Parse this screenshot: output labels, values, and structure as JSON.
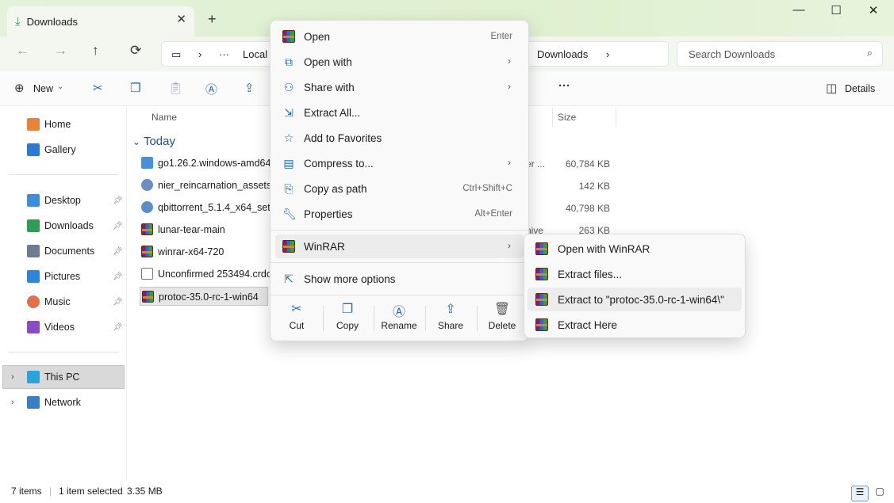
{
  "window": {
    "tab_title": "Downloads",
    "new_tab": "+",
    "minimize": "—",
    "maximize": "☐",
    "close": "✕"
  },
  "nav": {
    "back": "←",
    "forward": "→",
    "up": "↑",
    "refresh": "⟳",
    "address_ellipsis": "···",
    "address_local": "Local",
    "address_current": "Downloads",
    "search_placeholder": "Search Downloads"
  },
  "commandbar": {
    "new_label": "New",
    "more": "···",
    "details_label": "Details"
  },
  "sidebar": {
    "items_top": [
      {
        "label": "Home",
        "color": "#e8833a"
      },
      {
        "label": "Gallery",
        "color": "#2b78d6"
      }
    ],
    "items_quick": [
      {
        "label": "Desktop",
        "color": "#3a8fd6"
      },
      {
        "label": "Downloads",
        "color": "#2e9d53"
      },
      {
        "label": "Documents",
        "color": "#6b7c93"
      },
      {
        "label": "Pictures",
        "color": "#2f86d8"
      },
      {
        "label": "Music",
        "color": "#e0704a"
      },
      {
        "label": "Videos",
        "color": "#8a4bc7"
      }
    ],
    "this_pc": "This PC",
    "network": "Network"
  },
  "filelist": {
    "col_name": "Name",
    "col_size": "Size",
    "group_today": "Today",
    "files": [
      {
        "name": "go1.26.2.windows-amd64",
        "type": "er ...",
        "size": "60,784 KB",
        "color": "#4a90d9"
      },
      {
        "name": "nier_reincarnation_assets_a",
        "type": "",
        "size": "142 KB",
        "color": "#6c8cc4"
      },
      {
        "name": "qbittorrent_5.1.4_x64_setup",
        "type": "",
        "size": "40,798 KB",
        "color": "#5a8fc6"
      },
      {
        "name": "lunar-tear-main",
        "type": "hive",
        "size": "263 KB",
        "color": "rar"
      },
      {
        "name": "winrar-x64-720",
        "type": "",
        "size": "",
        "color": "rar"
      },
      {
        "name": "Unconfirmed 253494.crdov",
        "type": "",
        "size": "",
        "color": "#ffffff"
      },
      {
        "name": "protoc-35.0-rc-1-win64",
        "type": "",
        "size": "",
        "color": "rar"
      }
    ]
  },
  "status": {
    "items": "7 items",
    "selected": "1 item selected",
    "size": "3.35 MB"
  },
  "context_menu": {
    "items": [
      {
        "label": "Open",
        "key": "Enter",
        "arrow": ""
      },
      {
        "label": "Open with",
        "key": "",
        "arrow": "›"
      },
      {
        "label": "Share with",
        "key": "",
        "arrow": "›"
      },
      {
        "label": "Extract All...",
        "key": "",
        "arrow": ""
      },
      {
        "label": "Add to Favorites",
        "key": "",
        "arrow": ""
      },
      {
        "label": "Compress to...",
        "key": "",
        "arrow": "›"
      },
      {
        "label": "Copy as path",
        "key": "Ctrl+Shift+C",
        "arrow": ""
      },
      {
        "label": "Properties",
        "key": "Alt+Enter",
        "arrow": ""
      }
    ],
    "winrar": "WinRAR",
    "winrar_arrow": "›",
    "show_more": "Show more options",
    "actions": {
      "cut": "Cut",
      "copy": "Copy",
      "rename": "Rename",
      "share": "Share",
      "delete": "Delete"
    }
  },
  "winrar_submenu": {
    "items": [
      "Open with WinRAR",
      "Extract files...",
      "Extract to \"protoc-35.0-rc-1-win64\\\"",
      "Extract Here"
    ]
  }
}
